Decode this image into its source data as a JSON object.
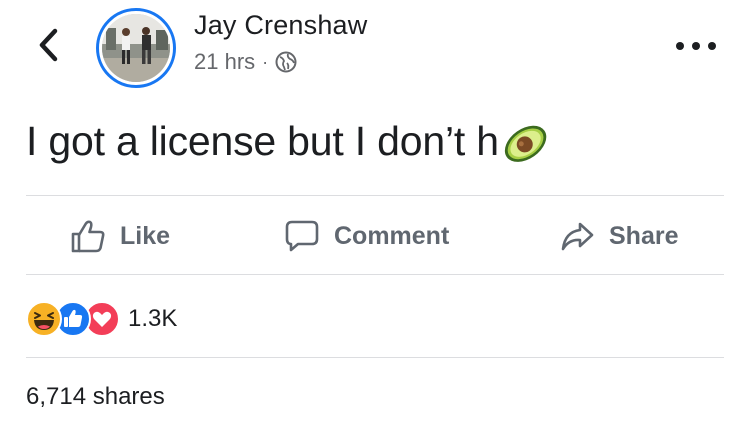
{
  "header": {
    "author_name": "Jay Crenshaw",
    "timestamp": "21 hrs",
    "separator": "·",
    "privacy_icon": "globe-icon",
    "back_icon": "chevron-left-icon",
    "more_icon": "more-options-icon"
  },
  "post": {
    "text": "I got a license but I don’t h",
    "emoji": "avocado-emoji"
  },
  "actions": {
    "like_label": "Like",
    "comment_label": "Comment",
    "share_label": "Share"
  },
  "reactions": {
    "icons": [
      "haha-icon",
      "like-icon",
      "love-icon"
    ],
    "count": "1.3K"
  },
  "shares": {
    "text": "6,714 shares"
  },
  "colors": {
    "accent": "#1877f2",
    "text": "#1c1e21",
    "muted": "#65676b",
    "action": "#606770",
    "love": "#f33e58",
    "haha": "#f7b125"
  }
}
